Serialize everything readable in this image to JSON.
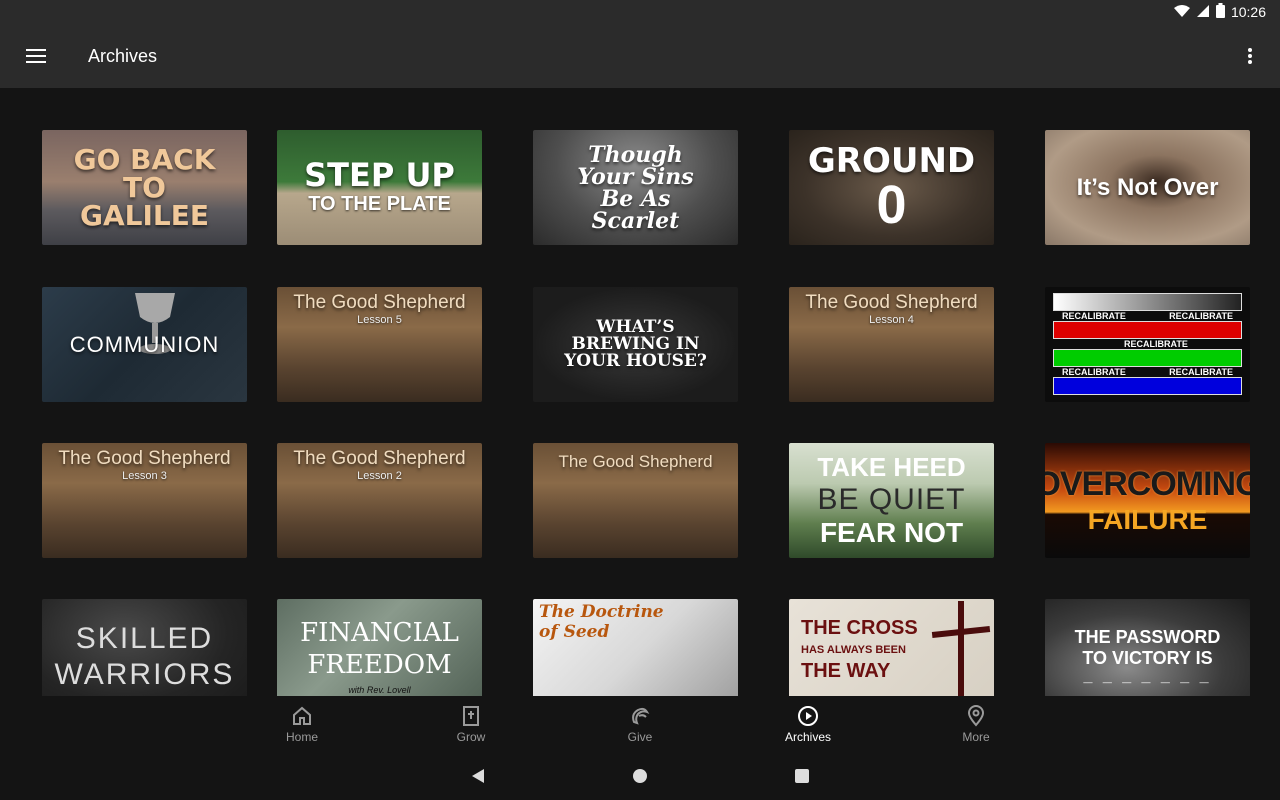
{
  "status": {
    "time": "10:26"
  },
  "appbar": {
    "title": "Archives"
  },
  "tiles": [
    {
      "title": "GO BACK TO GALILEE",
      "sub": ""
    },
    {
      "title": "STEP UP",
      "sub": "TO THE PLATE"
    },
    {
      "title": "Though Your Sins Be As Scarlet",
      "sub": ""
    },
    {
      "title": "GROUND",
      "sub": "0"
    },
    {
      "title": "It’s Not Over",
      "sub": ""
    },
    {
      "title": "COMMUNION",
      "sub": ""
    },
    {
      "title": "The Good Shepherd",
      "sub": "Lesson 5"
    },
    {
      "title": "WHAT’S BREWING IN YOUR HOUSE?",
      "sub": ""
    },
    {
      "title": "The Good Shepherd",
      "sub": "Lesson 4"
    },
    {
      "title": "RECALIBRATE",
      "sub": ""
    },
    {
      "title": "The Good Shepherd",
      "sub": "Lesson 3"
    },
    {
      "title": "The Good Shepherd",
      "sub": "Lesson 2"
    },
    {
      "title": "The Good Shepherd",
      "sub": ""
    },
    {
      "title": "TAKE HEED",
      "sub": "BE QUIET",
      "sub2": "FEAR NOT"
    },
    {
      "title": "OVERCOMING",
      "sub": "FAILURE"
    },
    {
      "title": "SKILLED",
      "sub": "WARRIORS"
    },
    {
      "title": "FINANCIAL",
      "sub": "FREEDOM",
      "sub2": "with Rev. Lovell"
    },
    {
      "title": "The Doctrine",
      "sub": "of Seed"
    },
    {
      "title": "THE CROSS",
      "sub": "HAS ALWAYS BEEN",
      "sub2": "THE WAY"
    },
    {
      "title": "THE PASSWORD",
      "sub": "TO VICTORY IS",
      "sub2": "_ _ _ _ _ _ _"
    }
  ],
  "nav": {
    "items": [
      {
        "label": "Home"
      },
      {
        "label": "Grow"
      },
      {
        "label": "Give"
      },
      {
        "label": "Archives"
      },
      {
        "label": "More"
      }
    ],
    "active_color": "#ffffff",
    "inactive_color": "#9a9a9a"
  }
}
